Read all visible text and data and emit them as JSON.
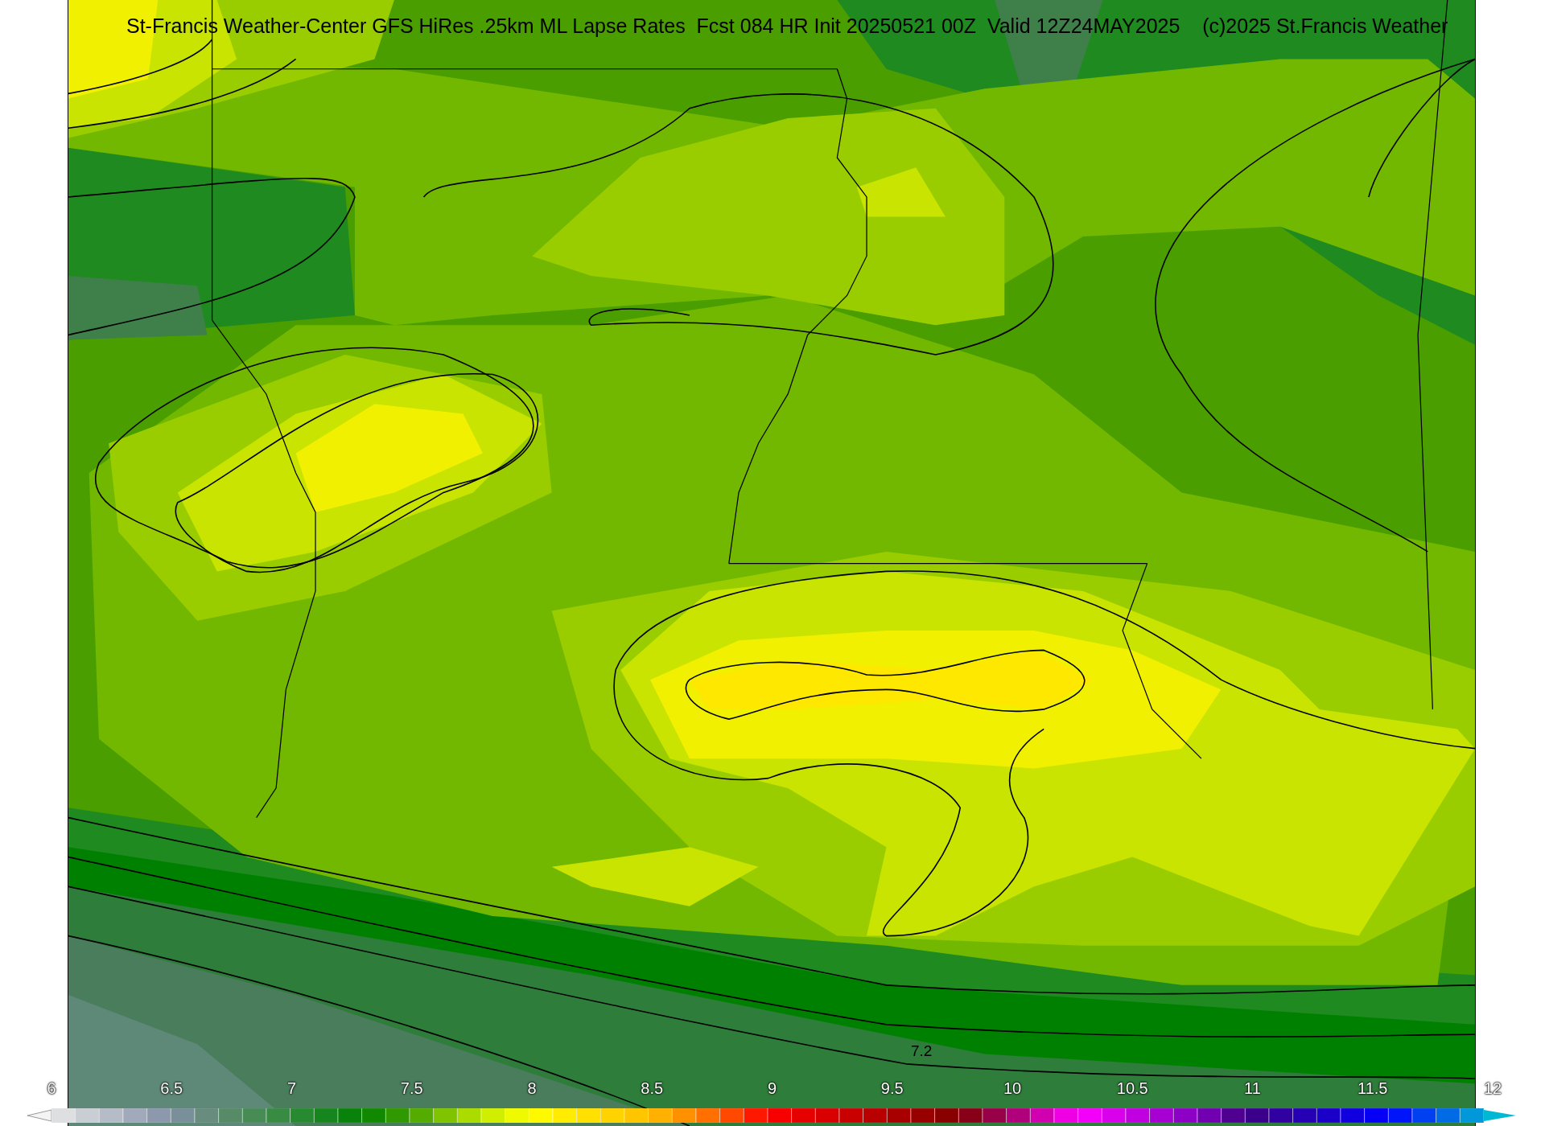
{
  "title": "St-Francis Weather-Center GFS HiRes .25km ML Lapse Rates  Fcst 084 HR Init 20250521 00Z  Valid 12Z24MAY2025    (c)2025 St.Francis Weather",
  "map": {
    "contour_label": "7.2"
  },
  "colorbar": {
    "ticks": [
      "6",
      "6.5",
      "7",
      "7.5",
      "8",
      "8.5",
      "9",
      "9.5",
      "10",
      "10.5",
      "11",
      "11.5",
      "12"
    ]
  }
}
